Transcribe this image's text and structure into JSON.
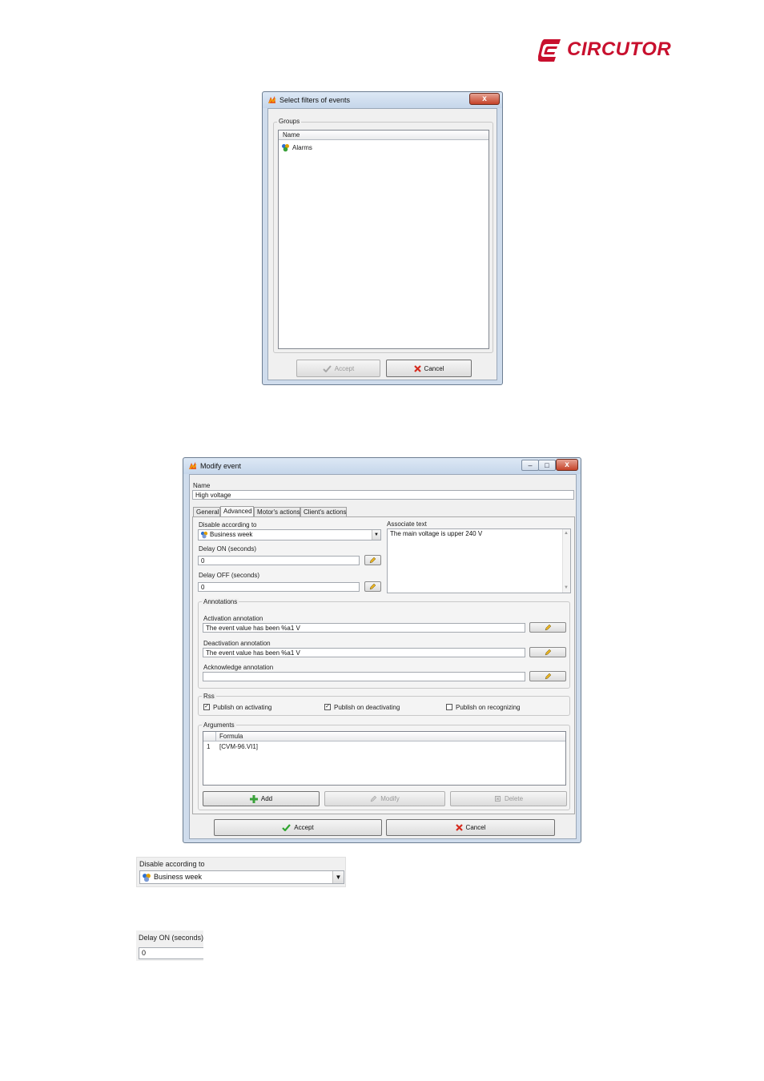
{
  "brand": {
    "logo_text": "CIRCUTOR",
    "color": "#c8102e"
  },
  "select_filters_dialog": {
    "title": "Select filters of events",
    "close_glyph": "x",
    "groups_label": "Groups",
    "column_name": "Name",
    "items": [
      {
        "label": "Alarms",
        "icon": "group-icon"
      }
    ],
    "accept_label": "Accept",
    "cancel_label": "Cancel"
  },
  "modify_event_dialog": {
    "title": "Modify event",
    "name_label": "Name",
    "name_value": "High voltage",
    "tabs": [
      {
        "label": "General"
      },
      {
        "label": "Advanced",
        "active": true
      },
      {
        "label": "Motor's actions"
      },
      {
        "label": "Client's actions"
      }
    ],
    "disable_label": "Disable according to",
    "disable_value": "Business week",
    "delay_on_label": "Delay ON (seconds)",
    "delay_on_value": "0",
    "delay_off_label": "Delay OFF (seconds)",
    "delay_off_value": "0",
    "associate_text_label": "Associate text",
    "associate_text_value": "The main voltage is upper 240 V",
    "annotations_label": "Annotations",
    "activation_annotation_label": "Activation annotation",
    "activation_annotation_value": "The event value has been %a1 V",
    "deactivation_annotation_label": "Deactivation annotation",
    "deactivation_annotation_value": "The event value has been %a1 V",
    "acknowledge_annotation_label": "Acknowledge annotation",
    "acknowledge_annotation_value": "",
    "rss_label": "Rss",
    "rss_options": [
      {
        "label": "Publish on activating",
        "checked": true
      },
      {
        "label": "Publish on deactivating",
        "checked": true
      },
      {
        "label": "Publish on recognizing",
        "checked": false
      }
    ],
    "arguments_label": "Arguments",
    "formula_header": "Formula",
    "arguments": [
      {
        "index": "1",
        "formula": "[CVM-96.VI1]"
      }
    ],
    "add_label": "Add",
    "modify_label": "Modify",
    "delete_label": "Delete",
    "accept_label": "Accept",
    "cancel_label": "Cancel"
  },
  "zoom_disable": {
    "label": "Disable according to",
    "value": "Business week"
  },
  "zoom_delay": {
    "label": "Delay ON (seconds)",
    "value": "0"
  }
}
